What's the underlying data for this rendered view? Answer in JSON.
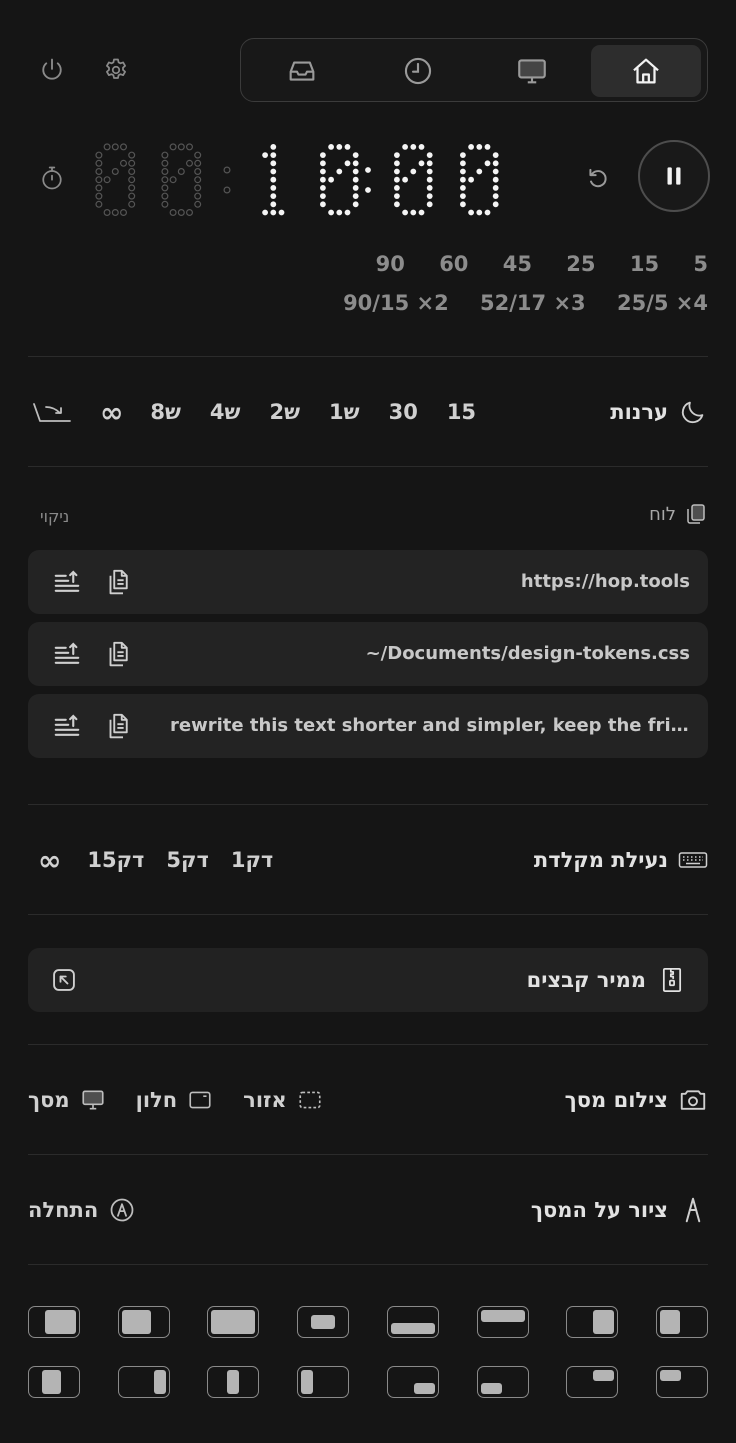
{
  "topbar": {
    "power_icon": "power-icon",
    "settings_icon": "gear-icon",
    "tabs": [
      {
        "icon": "home-icon",
        "active": true
      },
      {
        "icon": "monitor-icon",
        "active": false
      },
      {
        "icon": "clock-icon",
        "active": false
      },
      {
        "icon": "inbox-icon",
        "active": false
      }
    ]
  },
  "timer": {
    "hours": "00",
    "minutes": "10",
    "seconds": "00",
    "display": "00:10:00",
    "presets_minutes": [
      "5",
      "15",
      "25",
      "45",
      "60",
      "90"
    ],
    "presets_cycles": [
      "25/5 ×4",
      "52/17 ×3",
      "90/15 ×2"
    ]
  },
  "awake": {
    "title": "ערנות",
    "options": [
      "15",
      "30",
      "1ש",
      "2ש",
      "4ש",
      "8ש"
    ],
    "infinity": "∞"
  },
  "clipboard": {
    "title": "לוח",
    "clear_label": "ניקוי",
    "items": [
      {
        "text": "https://hop.tools"
      },
      {
        "text": "~/Documents/design-tokens.css"
      },
      {
        "text": "rewrite this text shorter and simpler, keep the friendly tone and the key points"
      }
    ]
  },
  "keyboard_lock": {
    "title": "נעילת מקלדת",
    "options": [
      "1דק",
      "5דק",
      "15דק"
    ],
    "infinity": "∞"
  },
  "file_converter": {
    "title": "ממיר קבצים"
  },
  "screenshot": {
    "title": "צילום מסך",
    "options": [
      "אזור",
      "חלון",
      "מסך"
    ]
  },
  "draw": {
    "title": "ציור על המסך",
    "start_label": "התחלה"
  },
  "window_layouts": {
    "count": 16
  }
}
